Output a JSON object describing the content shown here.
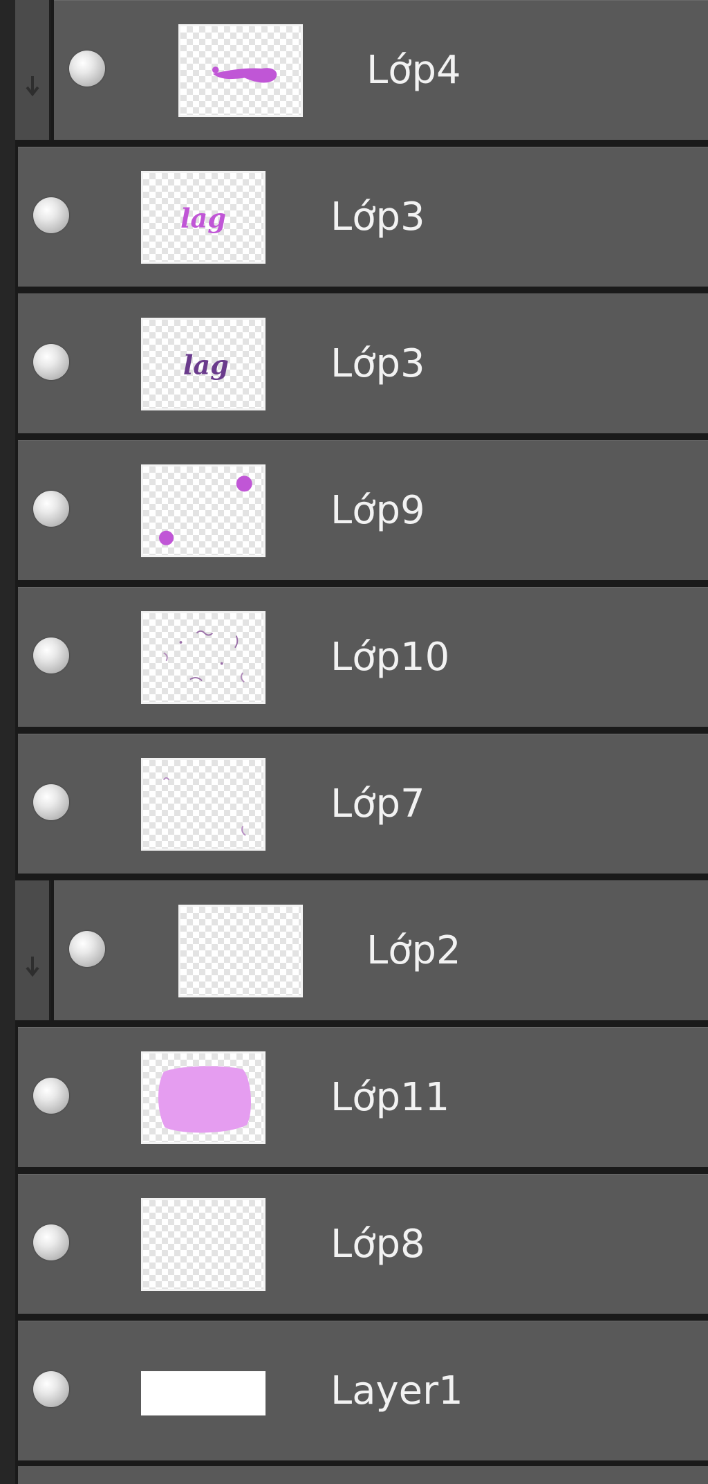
{
  "layers_panel": {
    "layers": [
      {
        "name": "Lớp4",
        "clipped": true,
        "content": "brush-stroke"
      },
      {
        "name": "Lớp3",
        "clipped": false,
        "content": "text-lag-light"
      },
      {
        "name": "Lớp3",
        "clipped": false,
        "content": "text-lag-dark"
      },
      {
        "name": "Lớp9",
        "clipped": false,
        "content": "dots"
      },
      {
        "name": "Lớp10",
        "clipped": false,
        "content": "scribbles"
      },
      {
        "name": "Lớp7",
        "clipped": false,
        "content": "faint-marks"
      },
      {
        "name": "Lớp2",
        "clipped": true,
        "content": "empty"
      },
      {
        "name": "Lớp11",
        "clipped": false,
        "content": "pink-fill"
      },
      {
        "name": "Lớp8",
        "clipped": false,
        "content": "empty"
      },
      {
        "name": "Layer1",
        "clipped": false,
        "content": "white-fill"
      }
    ],
    "thumb_text": "lag",
    "colors": {
      "row_bg": "#595959",
      "separator": "#1a1a1a",
      "label": "#f2f2f2",
      "accent_purple": "#c056d6",
      "accent_dark_purple": "#6a3b8c",
      "pink_fill": "#e59df0"
    },
    "icons": {
      "visibility": "eye-toggle-icon",
      "clip": "clipping-mask-arrow-icon"
    }
  }
}
